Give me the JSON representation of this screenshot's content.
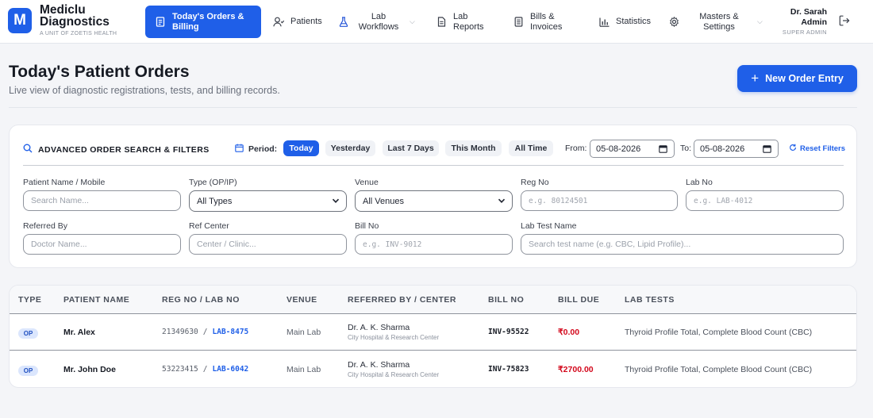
{
  "brand": {
    "logo_letter": "M",
    "name": "Mediclu Diagnostics",
    "tagline": "A UNIT OF ZOETIS HEALTH",
    "accent_color": "#1f5fe8"
  },
  "nav": {
    "items": [
      {
        "label": "Today's Orders & Billing",
        "icon": "receipt-icon",
        "active": true
      },
      {
        "label": "Patients",
        "icon": "user-icon"
      },
      {
        "label": "Lab Workflows",
        "icon": "flask-icon",
        "has_dropdown": true
      },
      {
        "label": "Lab Reports",
        "icon": "document-icon"
      },
      {
        "label": "Bills & Invoices",
        "icon": "invoice-icon"
      },
      {
        "label": "Statistics",
        "icon": "bar-chart-icon"
      },
      {
        "label": "Masters & Settings",
        "icon": "gear-icon",
        "has_dropdown": true
      }
    ]
  },
  "user": {
    "name": "Dr. Sarah Admin",
    "role": "SUPER ADMIN"
  },
  "page": {
    "title": "Today's Patient Orders",
    "subtitle": "Live view of diagnostic registrations, tests, and billing records.",
    "new_order_label": "New Order Entry"
  },
  "filters": {
    "title": "ADVANCED ORDER SEARCH & FILTERS",
    "period_label": "Period:",
    "periods": [
      "Today",
      "Yesterday",
      "Last 7 Days",
      "This Month",
      "All Time"
    ],
    "active_period": "Today",
    "from_label": "From:",
    "from_value": "05-08-2026",
    "to_label": "To:",
    "to_value": "05-08-2026",
    "reset_label": "Reset Filters",
    "fields": {
      "patient": {
        "label": "Patient Name / Mobile",
        "placeholder": "Search Name..."
      },
      "type": {
        "label": "Type (OP/IP)",
        "value": "All Types"
      },
      "venue": {
        "label": "Venue",
        "value": "All Venues"
      },
      "reg_no": {
        "label": "Reg No",
        "placeholder": "e.g. 80124501"
      },
      "lab_no": {
        "label": "Lab No",
        "placeholder": "e.g. LAB-4012"
      },
      "referred_by": {
        "label": "Referred By",
        "placeholder": "Doctor Name..."
      },
      "ref_center": {
        "label": "Ref Center",
        "placeholder": "Center / Clinic..."
      },
      "bill_no": {
        "label": "Bill No",
        "placeholder": "e.g. INV-9012"
      },
      "lab_test": {
        "label": "Lab Test Name",
        "placeholder": "Search test name (e.g. CBC, Lipid Profile)..."
      }
    }
  },
  "table": {
    "headers": [
      "TYPE",
      "PATIENT NAME",
      "REG NO / LAB NO",
      "VENUE",
      "REFERRED BY / CENTER",
      "BILL NO",
      "BILL DUE",
      "LAB TESTS"
    ],
    "rows": [
      {
        "type": "OP",
        "patient": "Mr. Alex",
        "reg_no": "21349630",
        "separator": "/",
        "lab_no": "LAB-8475",
        "venue": "Main Lab",
        "doctor": "Dr. A. K. Sharma",
        "center": "City Hospital & Research Center",
        "bill_no": "INV-95522",
        "bill_due": "₹0.00",
        "tests": "Thyroid Profile Total, Complete Blood Count (CBC)"
      },
      {
        "type": "OP",
        "patient": "Mr. John Doe",
        "reg_no": "53223415",
        "separator": "/",
        "lab_no": "LAB-6042",
        "venue": "Main Lab",
        "doctor": "Dr. A. K. Sharma",
        "center": "City Hospital & Research Center",
        "bill_no": "INV-75823",
        "bill_due": "₹2700.00",
        "tests": "Thyroid Profile Total, Complete Blood Count (CBC)"
      }
    ]
  }
}
